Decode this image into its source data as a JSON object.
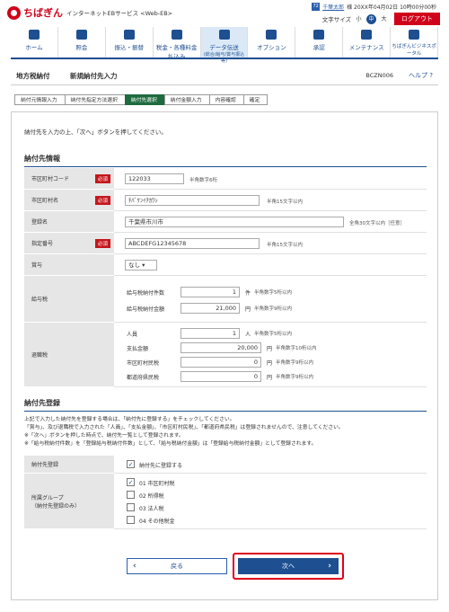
{
  "header": {
    "logo": "ちばぎん",
    "service": "インターネットEBサービス <Web-EB>",
    "user_icon": "72",
    "user_name": "千葉太郎",
    "user_suffix": "様 20XX年04月02日 10時00分00秒",
    "font_size_label": "文字サイズ",
    "font_small": "小",
    "font_mid": "中",
    "font_large": "大",
    "logout": "ログアウト"
  },
  "nav": [
    {
      "label": "ホーム"
    },
    {
      "label": "照会"
    },
    {
      "label": "振込・振替"
    },
    {
      "label": "税金・各種料金払込み"
    },
    {
      "label": "データ伝送",
      "sub": "(総合/給与/賞与振込等)"
    },
    {
      "label": "オプション"
    },
    {
      "label": "承認"
    },
    {
      "label": "メンテナンス"
    },
    {
      "label": "ちばぎんビジネスポータル"
    }
  ],
  "title": {
    "main": "地方税納付",
    "sub": "新規納付先入力",
    "code": "BCZN006",
    "help": "ヘルプ"
  },
  "steps": [
    "納付元情報入力",
    "納付先指定方法選択",
    "納付先選択",
    "納付金額入力",
    "内容確認",
    "確定"
  ],
  "intro": "納付先を入力の上、「次へ」ボタンを押してください。",
  "payee": {
    "title": "納付先情報",
    "city_code_label": "市区町村コード",
    "city_code": "122033",
    "city_code_hint": "半角数字6桁",
    "city_name_label": "市区町村名",
    "city_name": "ﾁﾊﾞｹﾝｲﾁｶﾜｼ",
    "city_name_hint": "半角15文字以内",
    "reg_name_label": "登録名",
    "reg_name": "千葉県市川市",
    "reg_name_hint": "全角30文字以内［任意］",
    "spec_no_label": "指定番号",
    "spec_no": "ABCDEFG12345678",
    "spec_no_hint": "半角15文字以内",
    "required": "必須",
    "bonus_label": "賞与",
    "bonus_value": "なし",
    "salary_label": "給与税",
    "salary_count_label": "給与税納付件数",
    "salary_count": "1",
    "salary_count_unit": "件",
    "salary_count_hint": "半角数字5桁以内",
    "salary_amount_label": "給与税納付金額",
    "salary_amount": "21,000",
    "salary_amount_unit": "円",
    "salary_amount_hint": "半角数字9桁以内",
    "ret_label": "退職税",
    "ret_people_label": "人員",
    "ret_people": "1",
    "ret_people_unit": "人",
    "ret_people_hint": "半角数字5桁以内",
    "ret_pay_label": "支払金額",
    "ret_pay": "20,000",
    "ret_pay_unit": "円",
    "ret_pay_hint": "半角数字10桁以内",
    "ret_city_label": "市区町村民税",
    "ret_city": "0",
    "ret_city_unit": "円",
    "ret_city_hint": "半角数字9桁以内",
    "ret_pref_label": "都道府県民税",
    "ret_pref": "0",
    "ret_pref_unit": "円",
    "ret_pref_hint": "半角数字9桁以内"
  },
  "register": {
    "title": "納付先登録",
    "note1": "上記で入力した納付先を登録する場合は、「納付先に登録する」をチェックしてください。",
    "note2": "「賞与」、及び退職税で入力された「人員」、「支払金額」、「市区町村民税」、「都道府県民税」は登録されませんので、注意してください。",
    "note3": "※「次へ」ボタンを押した時点で、納付先一覧として登録されます。",
    "note4": "※「給与税納付件数」を「登録給与税納付件数」として、「給与税納付金額」は「登録給与税納付金額」として登録されます。",
    "reg_label": "納付先登録",
    "reg_check": "納付先に登録する",
    "group_label": "所属グループ",
    "group_sub": "（納付先登録のみ）",
    "groups": [
      "01 市区町村税",
      "02 所得税",
      "03 法人税",
      "04 その他税金"
    ]
  },
  "buttons": {
    "back": "戻る",
    "next": "次へ"
  }
}
